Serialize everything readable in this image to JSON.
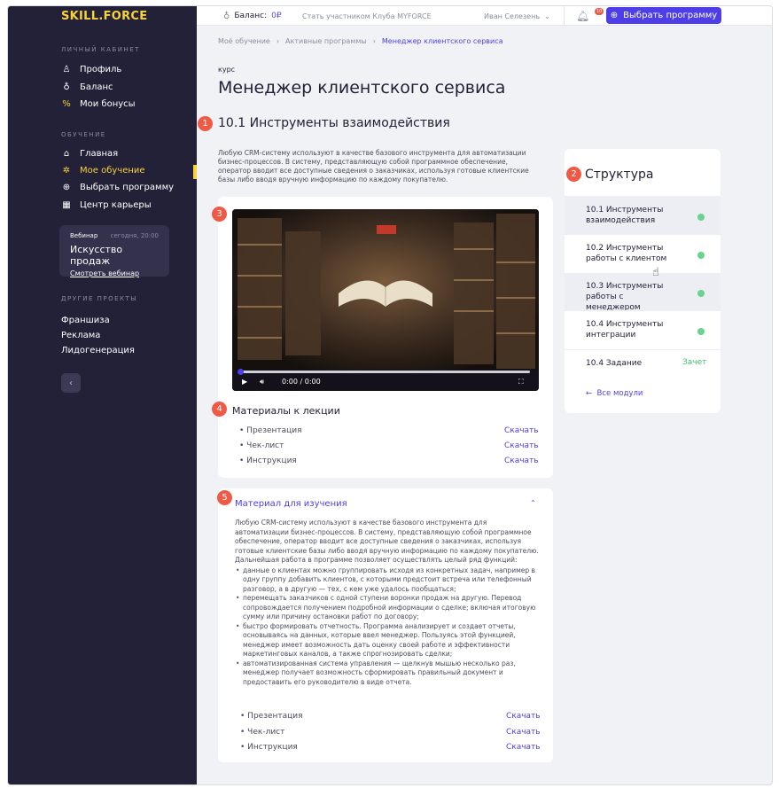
{
  "sidebar": {
    "logo": "SKILL.FORCE",
    "section_personal": "ЛИЧНЫЙ КАБИНЕТ",
    "personal_items": [
      {
        "label": "Профиль",
        "icon": "user-icon"
      },
      {
        "label": "Баланс",
        "icon": "wallet-icon"
      },
      {
        "label": "Мои бонусы",
        "icon": "percent-icon"
      }
    ],
    "section_learning": "ОБУЧЕНИЕ",
    "learning_items": [
      {
        "label": "Главная",
        "icon": "home-icon"
      },
      {
        "label": "Мое обучение",
        "icon": "gear-icon",
        "active": true
      },
      {
        "label": "Выбрать программу",
        "icon": "plus-circle-icon"
      },
      {
        "label": "Центр карьеры",
        "icon": "grid-icon"
      }
    ],
    "webinar": {
      "tag": "Вебинар",
      "time": "сегодня, 20:00",
      "title": "Искусство продаж",
      "link": "Смотреть вебинар"
    },
    "section_other": "ДРУГИЕ ПРОЕКТЫ",
    "other_items": [
      "Франшиза",
      "Реклама",
      "Лидогенерация"
    ],
    "collapse_icon": "collapse-icon",
    "active_color": "#f7d33a"
  },
  "topbar": {
    "balance_label": "Баланс:",
    "balance_value": "0₽",
    "club_link": "Стать участником Клуба MYFORCE",
    "user_name": "Иван Селезень",
    "notification_count": "10",
    "cta_label": "Выбрать программу",
    "accent_color": "#4d3ee8"
  },
  "breadcrumb": [
    "Моё обучение",
    "Активные программы",
    "Менеджер клиентского сервиса"
  ],
  "course": {
    "kind": "курс",
    "title": "Менеджер клиентского сервиса",
    "lesson_title": "10.1 Инструменты взаимодействия",
    "intro": "Любую CRM-систему используют в качестве базового инструмента для автоматизации бизнес-процессов. В систему, представляющую собой программное обеспечение, оператор вводит все доступные сведения о заказчиках, используя готовые клиентские базы либо вводя вручную информацию по каждому покупателю."
  },
  "markers": [
    "1",
    "2",
    "3",
    "4",
    "5"
  ],
  "video": {
    "time": "0:00 / 0:00",
    "progress": 0
  },
  "materials": {
    "title": "Материалы к лекции",
    "download_label": "Скачать",
    "items": [
      "Презентация",
      "Чек-лист",
      "Инструкция"
    ]
  },
  "study": {
    "title": "Материал для изучения",
    "paragraph": "Любую CRM-систему используют в качестве базового инструмента для автоматизации бизнес-процессов. В систему, представляющую собой программное обеспечение, оператор вводит все доступные сведения о заказчиках, используя готовые клиентские базы либо вводя вручную информацию по каждому покупателю. Дальнейшая работа в программе позволяет осуществлять целый ряд функций:",
    "bullets": [
      "данные о клиентах можно группировать исходя из конкретных задач, например в одну группу добавить клиентов, с которыми предстоит встреча или телефонный разговор, а в другую — тех, с кем уже удалось пообщаться;",
      "перемещать заказчиков с одной ступени воронки продаж на другую. Перевод сопровождается получением подробной информации о сделке; включая итоговую сумму или причину остановки работ по договору;",
      "быстро формировать отчетность. Программа анализирует и создает отчеты, основываясь на данных, которые ввел менеджер. Пользуясь этой функцией, менеджер имеет возможность дать оценку своей работе и эффективности маркетинговых каналов, а также спрогнозировать сделки;",
      "автоматизированная система управления — щелкнув мышью несколько раз, менеджер получает возможность сформировать правильный документ и предоставить его руководителю в виде отчета."
    ],
    "items": [
      "Презентация",
      "Чек-лист",
      "Инструкция"
    ]
  },
  "structure": {
    "title": "Структура",
    "items": [
      {
        "label": "10.1 Инструменты взаимодействия",
        "status": "done"
      },
      {
        "label": "10.2 Инструменты работы с клиентом",
        "status": "done"
      },
      {
        "label": "10.3 Инструменты работы с менеджером",
        "status": "done"
      },
      {
        "label": "10.4 Инструменты интеграции",
        "status": "done"
      },
      {
        "label": "10.4 Задание",
        "status": "Зачет"
      }
    ],
    "all_modules": "Все модули"
  }
}
